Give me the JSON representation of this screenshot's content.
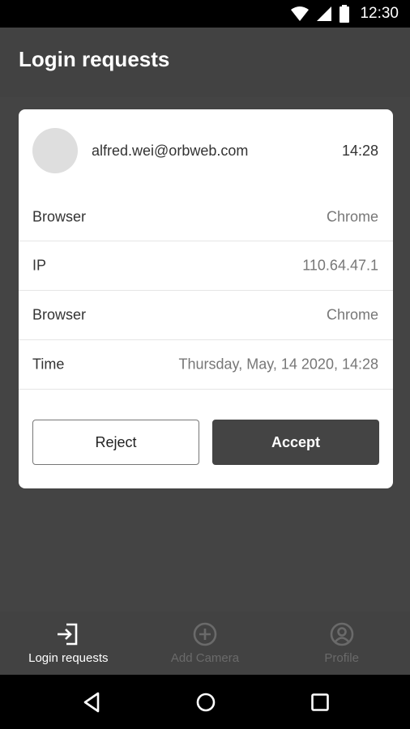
{
  "status_bar": {
    "time": "12:30",
    "icons": [
      "wifi-icon",
      "cellular-signal-icon",
      "battery-icon"
    ]
  },
  "header": {
    "title": "Login requests"
  },
  "request": {
    "email": "alfred.wei@orbweb.com",
    "time": "14:28",
    "details": [
      {
        "key": "Browser",
        "value": "Chrome"
      },
      {
        "key": "IP",
        "value": "110.64.47.1"
      },
      {
        "key": "Browser",
        "value": "Chrome"
      },
      {
        "key": "Time",
        "value": "Thursday, May, 14 2020, 14:28"
      }
    ],
    "actions": {
      "reject_label": "Reject",
      "accept_label": "Accept"
    }
  },
  "bottom_nav": {
    "items": [
      {
        "label": "Login requests",
        "icon": "login-icon",
        "active": true
      },
      {
        "label": "Add Camera",
        "icon": "add-circle-icon",
        "active": false
      },
      {
        "label": "Profile",
        "icon": "profile-icon",
        "active": false
      }
    ]
  },
  "system_nav": {
    "icons": [
      "back-icon",
      "home-icon",
      "recents-icon"
    ]
  },
  "colors": {
    "background": "#424242",
    "card": "#ffffff",
    "accept_button": "#444444",
    "nav_active": "#ffffff",
    "nav_inactive": "#6a6a6a"
  }
}
